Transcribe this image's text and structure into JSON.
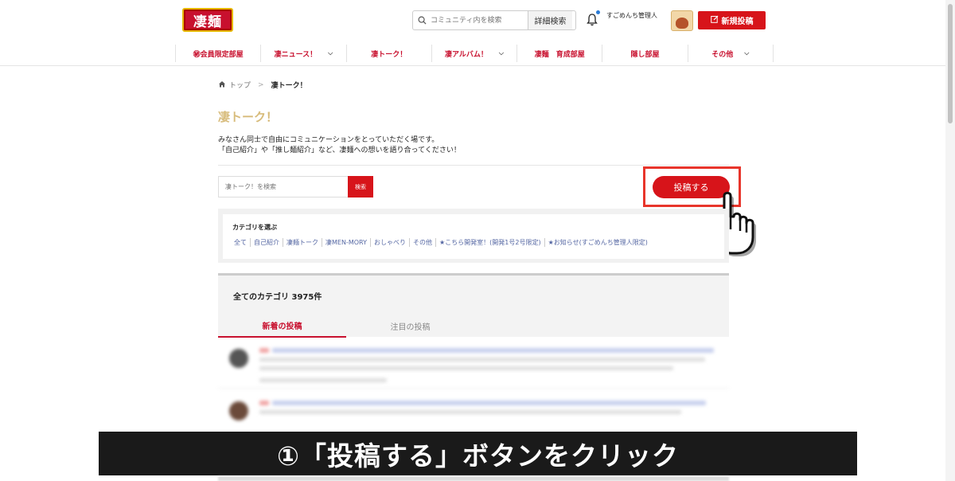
{
  "header": {
    "logo_text": "凄麺",
    "search_placeholder": "コミュニティ内を検索",
    "advanced_search_label": "詳細検索",
    "admin_name": "すごめんち管理人",
    "new_post_label": "新規投稿"
  },
  "nav": {
    "items": [
      {
        "label": "㊙会員限定部屋",
        "has_dropdown": false
      },
      {
        "label": "凄ニュース！",
        "has_dropdown": true
      },
      {
        "label": "凄トーク！",
        "has_dropdown": false
      },
      {
        "label": "凄アルバム！",
        "has_dropdown": true
      },
      {
        "label": "凄麺　育成部屋",
        "has_dropdown": false
      },
      {
        "label": "隠し部屋",
        "has_dropdown": false
      },
      {
        "label": "その他",
        "has_dropdown": true
      }
    ]
  },
  "breadcrumb": {
    "home": "トップ",
    "separator": ">",
    "current": "凄トーク！"
  },
  "page": {
    "title": "凄トーク！",
    "description_line1": "みなさん同士で自由にコミュニケーションをとっていただく場です。",
    "description_line2": "「自己紹介」や「推し麺紹介」など、凄麺への想いを語り合ってください！",
    "board_search_placeholder": "凄トーク！を検索",
    "board_search_button": "検索",
    "post_button_label": "投稿する"
  },
  "category": {
    "heading": "カテゴリを選ぶ",
    "items": [
      "全て",
      "自己紹介",
      "凄麺トーク",
      "凄MEN-MORY",
      "おしゃべり",
      "その他",
      "★こちら開発室！(開発1号2号限定)",
      "★お知らせ(すごめんち管理人限定)"
    ]
  },
  "listing": {
    "count_label": "全てのカテゴリ 3975件",
    "tabs": [
      {
        "label": "新着の投稿",
        "active": true
      },
      {
        "label": "注目の投稿",
        "active": false
      }
    ]
  },
  "caption": {
    "text": "①「投稿する」ボタンをクリック"
  },
  "colors": {
    "brand_red": "#d7141a",
    "title_gold": "#d7bb7a",
    "highlight_red": "#e8352b",
    "link_blue": "#5567a3"
  }
}
